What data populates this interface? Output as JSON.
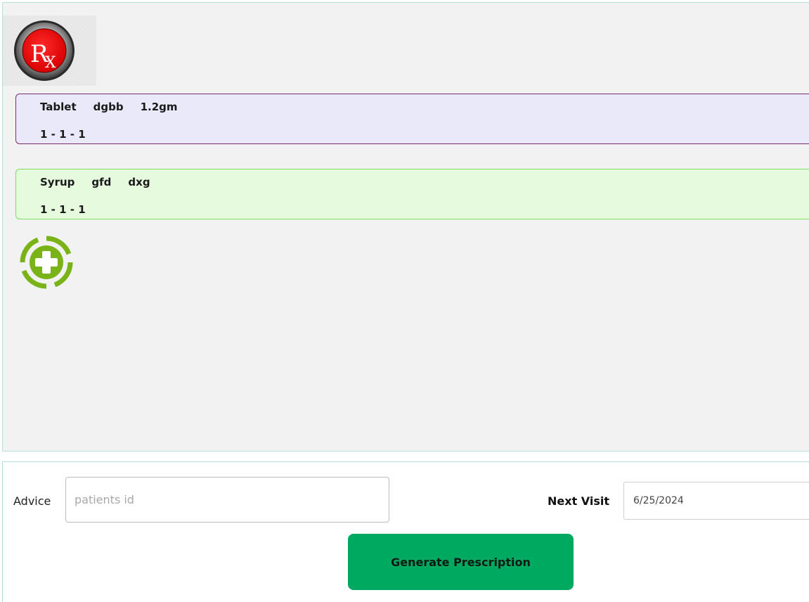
{
  "prescription": {
    "logo_icon": "rx-icon",
    "logo_text": "Rx",
    "medicines": [
      {
        "type": "Tablet",
        "name": "dgbb",
        "dose": "1.2gm",
        "schedule": "1 - 1 - 1",
        "background": "#e9e9fa",
        "border": "#7b2a74"
      },
      {
        "type": "Syrup",
        "name": "gfd",
        "dose": "dxg",
        "schedule": "1 - 1 - 1",
        "background": "#e6fbdd",
        "border": "#7ed860"
      }
    ],
    "add_icon": "add-circle-icon",
    "add_icon_color": "#7ab317"
  },
  "footer": {
    "advice_label": "Advice",
    "advice_placeholder": "patients id",
    "advice_value": "",
    "next_visit_label": "Next Visit",
    "next_visit_value": "6/25/2024",
    "generate_label": "Generate Prescription",
    "generate_color": "#00a960"
  }
}
